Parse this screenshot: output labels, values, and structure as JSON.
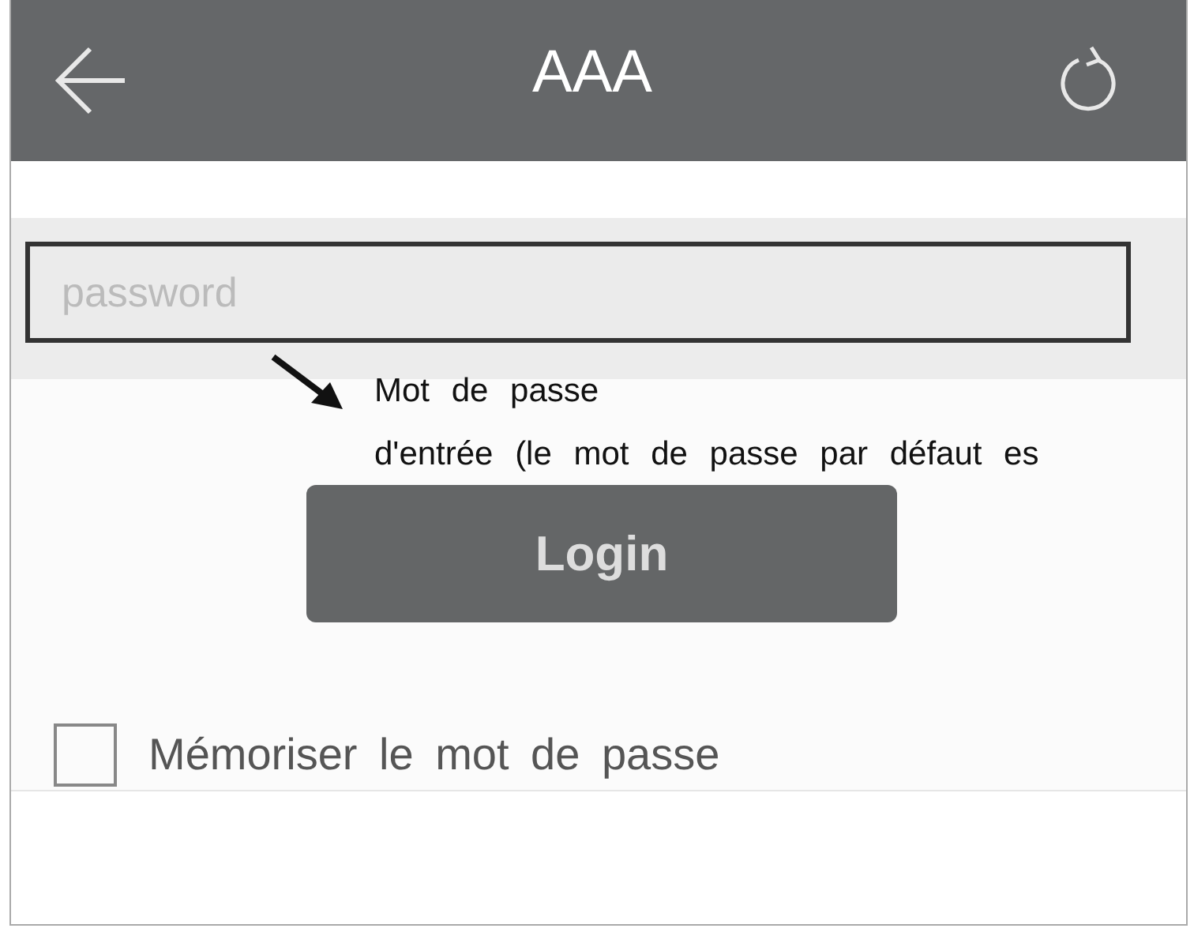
{
  "header": {
    "title": "AAA"
  },
  "password_field": {
    "placeholder": "password"
  },
  "annotation": {
    "lines": [
      "Mot de passe",
      "d'entrée (le mot de passe par défaut es"
    ]
  },
  "login_button": {
    "label": "Login"
  },
  "remember": {
    "label": "Mémoriser le mot de passe",
    "checked": false
  }
}
